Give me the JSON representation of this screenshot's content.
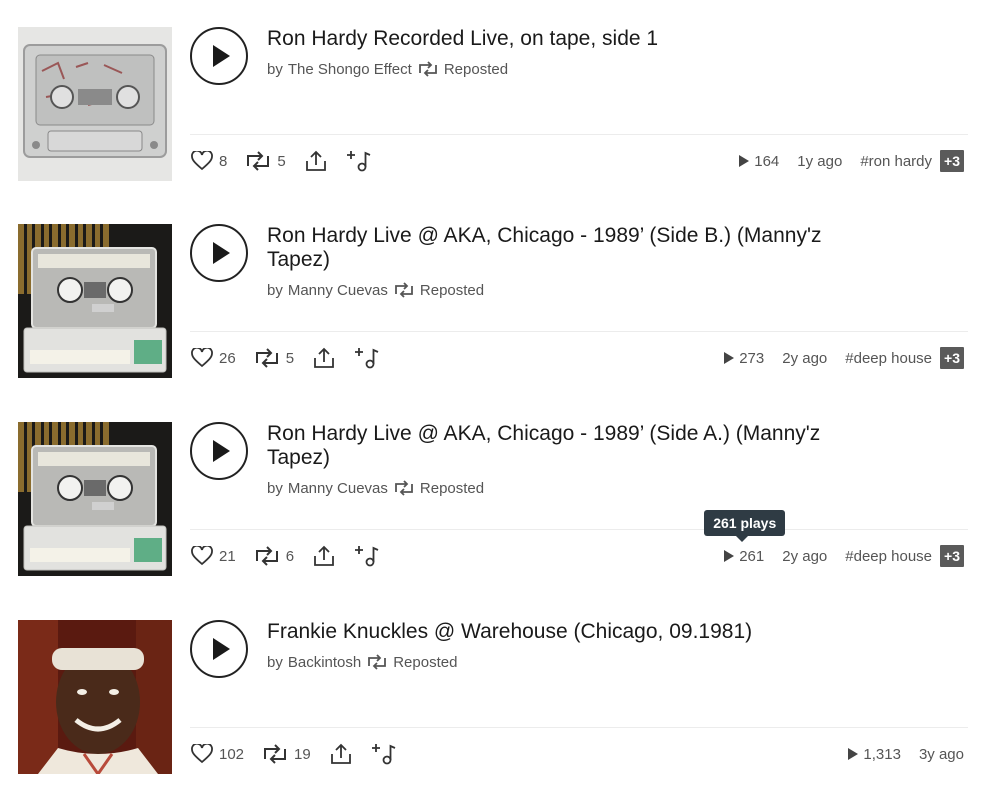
{
  "tracks": [
    {
      "title": "Ron Hardy Recorded Live, on tape, side 1",
      "artwork": "cassette-tape-artwork",
      "by_label": "by",
      "user": "The Shongo Effect",
      "repost_label": "Reposted",
      "likes": "8",
      "reposts": "5",
      "plays": "164",
      "age": "1y ago",
      "tag": "#ron hardy",
      "more_tags": "+3"
    },
    {
      "title": "Ron Hardy Live @ AKA, Chicago - 1989’ (Side B.) (Manny'z Tapez)",
      "artwork": "maxell-cassette-artwork",
      "by_label": "by",
      "user": "Manny Cuevas",
      "repost_label": "Reposted",
      "likes": "26",
      "reposts": "5",
      "plays": "273",
      "age": "2y ago",
      "tag": "#deep house",
      "more_tags": "+3"
    },
    {
      "title": "Ron Hardy Live @ AKA, Chicago - 1989’ (Side A.) (Manny'z Tapez)",
      "artwork": "maxell-cassette-artwork",
      "by_label": "by",
      "user": "Manny Cuevas",
      "repost_label": "Reposted",
      "likes": "21",
      "reposts": "6",
      "plays": "261",
      "plays_tooltip": "261 plays",
      "age": "2y ago",
      "tag": "#deep house",
      "more_tags": "+3"
    },
    {
      "title": "Frankie Knuckles @ Warehouse (Chicago, 09.1981)",
      "artwork": "portrait-photo-artwork",
      "by_label": "by",
      "user": "Backintosh",
      "repost_label": "Reposted",
      "likes": "102",
      "reposts": "19",
      "plays": "1,313",
      "age": "3y ago"
    }
  ]
}
